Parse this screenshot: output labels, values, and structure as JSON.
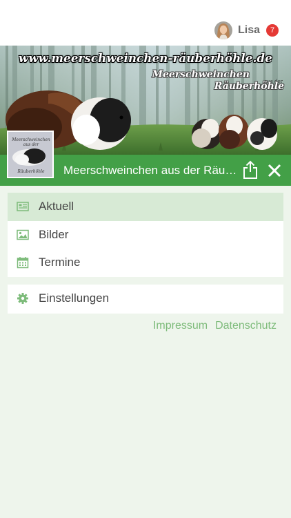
{
  "header": {
    "user_name": "Lisa",
    "notification_count": "7"
  },
  "banner": {
    "url_text": "www.meerschweinchen-räuberhöhle.de",
    "title_line1": "Meerschweinchen",
    "title_small": "aus der",
    "title_line2": "Räuberhöhle",
    "logo_text_top": "Meerschweinchen aus der",
    "logo_text_bottom": "Räuberhöhle"
  },
  "page_bar": {
    "title": "Meerschweinchen aus der Räuberhöhle"
  },
  "menu_main": [
    {
      "label": "Aktuell",
      "icon": "newspaper-icon",
      "active": true
    },
    {
      "label": "Bilder",
      "icon": "image-icon",
      "active": false
    },
    {
      "label": "Termine",
      "icon": "calendar-icon",
      "active": false
    }
  ],
  "menu_settings": [
    {
      "label": "Einstellungen",
      "icon": "gear-icon"
    }
  ],
  "footer": {
    "impressum": "Impressum",
    "datenschutz": "Datenschutz"
  },
  "colors": {
    "accent": "#43a047",
    "active_bg": "#d7ead5",
    "page_bg": "#eef5ec",
    "badge": "#e53935",
    "link": "#7dbb7a"
  }
}
